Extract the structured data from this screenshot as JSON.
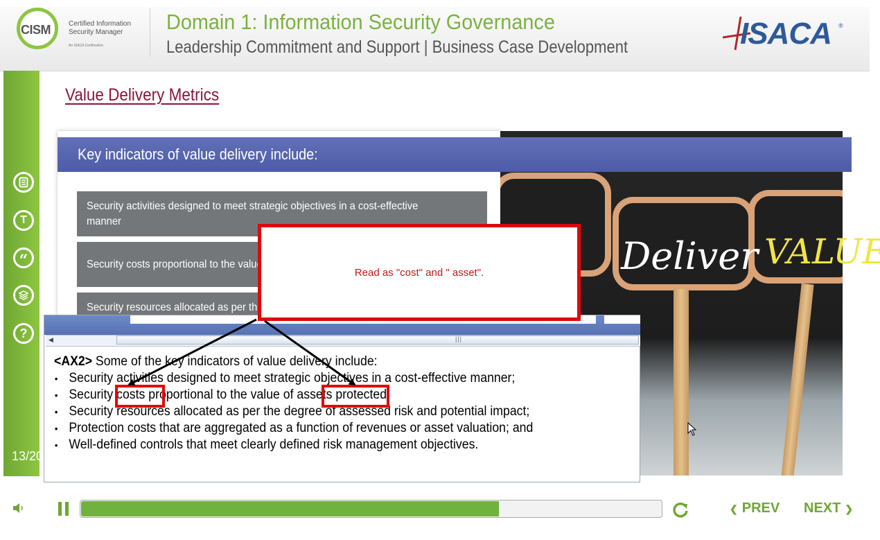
{
  "colors": {
    "brand_green": "#8dc63f",
    "header_blue": "#4e5ca8",
    "title_maroon": "#8b1538",
    "annotation_red": "#e0080a",
    "progress_green": "#6fb23e"
  },
  "header": {
    "logo_text": "CISM",
    "logo_line1": "Certified Information",
    "logo_line2": "Security Manager",
    "logo_line3": "An ISACA Certification",
    "title": "Domain 1: Information Security Governance",
    "subtitle": "Leadership Commitment and Support | Business Case Development",
    "brand": "ISACA",
    "brand_mark": "®"
  },
  "sidebar": {
    "items": [
      {
        "name": "notes",
        "icon": "notes-icon"
      },
      {
        "name": "transcript",
        "icon": "transcript-t-icon",
        "glyph": "T"
      },
      {
        "name": "quote",
        "icon": "quote-icon",
        "glyph": "“"
      },
      {
        "name": "resources",
        "icon": "layers-icon"
      },
      {
        "name": "help",
        "icon": "help-icon",
        "glyph": "?"
      }
    ],
    "page_counter": "13/20"
  },
  "slide": {
    "title": "Value Delivery Metrics",
    "banner": "Key indicators of value delivery include:",
    "items": [
      "Security activities designed to meet strategic objectives in a cost-effective manner",
      "Security costs proportional to the value of assets protected",
      "Security resources allocated as per the degree of assessed risk and potential impact"
    ],
    "image_text_1": "Deliver",
    "image_text_2": "VALUE"
  },
  "annotation": {
    "text": "Read as \"cost\" and \" asset\"."
  },
  "caption": {
    "tag": "<AX2>",
    "intro": " Some of the key indicators of value delivery include:",
    "bullets": [
      "Security activities designed to meet strategic objectives in a cost-effective manner;",
      "Security costs proportional to the value of assets protected;",
      "Security resources allocated as per the degree of assessed risk and potential impact;",
      "Protection costs that are aggregated as a function of revenues or asset valuation; and",
      "Well-defined controls that meet clearly defined risk management objectives."
    ]
  },
  "player": {
    "progress": 0.72,
    "prev_label": "PREV",
    "next_label": "NEXT",
    "prev_icon": "chevron-left-icon",
    "next_icon": "chevron-right-icon",
    "volume_icon": "volume-icon",
    "pause_icon": "pause-icon",
    "replay_icon": "replay-icon"
  }
}
